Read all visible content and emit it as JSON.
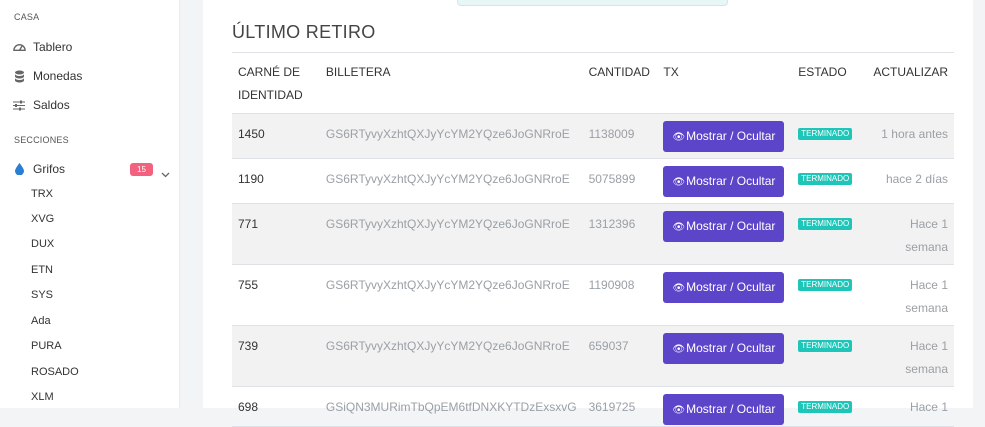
{
  "sidebar": {
    "section_home": "CASA",
    "home_items": [
      {
        "label": "Tablero",
        "icon": "dashboard-icon"
      },
      {
        "label": "Monedas",
        "icon": "database-icon"
      },
      {
        "label": "Saldos",
        "icon": "sliders-icon"
      }
    ],
    "section_sections": "SECCIONES",
    "faucets": {
      "label": "Grifos",
      "icon": "drop-icon",
      "badge": "15"
    },
    "sub_items": [
      "TRX",
      "XVG",
      "DUX",
      "ETN",
      "SYS",
      "Ada",
      "PURA",
      "ROSADO",
      "XLM"
    ]
  },
  "card": {
    "title": "ÚLTIMO RETIRO",
    "columns": {
      "id": "CARNÉ DE IDENTIDAD",
      "wallet": "BILLETERA",
      "qty": "CANTIDAD",
      "tx": "TX",
      "status": "ESTADO",
      "update": "ACTUALIZAR"
    },
    "rows": [
      {
        "id": "1450",
        "wallet": "GS6RTyvyXzhtQXJyYcYM2YQze6JoGNRroE",
        "qty": "1138009",
        "tx_button": "Mostrar / Ocultar",
        "status": "TERMINADO",
        "update": "1 hora antes"
      },
      {
        "id": "1190",
        "wallet": "GS6RTyvyXzhtQXJyYcYM2YQze6JoGNRroE",
        "qty": "5075899",
        "tx_button": "Mostrar / Ocultar",
        "status": "TERMINADO",
        "update": "hace 2 días"
      },
      {
        "id": "771",
        "wallet": "GS6RTyvyXzhtQXJyYcYM2YQze6JoGNRroE",
        "qty": "1312396",
        "tx_button": "Mostrar / Ocultar",
        "status": "TERMINADO",
        "update": "Hace 1 semana"
      },
      {
        "id": "755",
        "wallet": "GS6RTyvyXzhtQXJyYcYM2YQze6JoGNRroE",
        "qty": "1190908",
        "tx_button": "Mostrar / Ocultar",
        "status": "TERMINADO",
        "update": "Hace 1 semana"
      },
      {
        "id": "739",
        "wallet": "GS6RTyvyXzhtQXJyYcYM2YQze6JoGNRroE",
        "qty": "659037",
        "tx_button": "Mostrar / Ocultar",
        "status": "TERMINADO",
        "update": "Hace 1 semana"
      },
      {
        "id": "698",
        "wallet": "GSiQN3MURimTbQpEM6tfDNXKYTDzExsxvG",
        "qty": "3619725",
        "tx_button": "Mostrar / Ocultar",
        "status": "TERMINADO",
        "update": "Hace 1"
      }
    ]
  },
  "colors": {
    "accent": "#5c45c8",
    "status": "#1ec6b9",
    "badge": "#f2617e",
    "faucet_icon": "#2a7fd4"
  }
}
